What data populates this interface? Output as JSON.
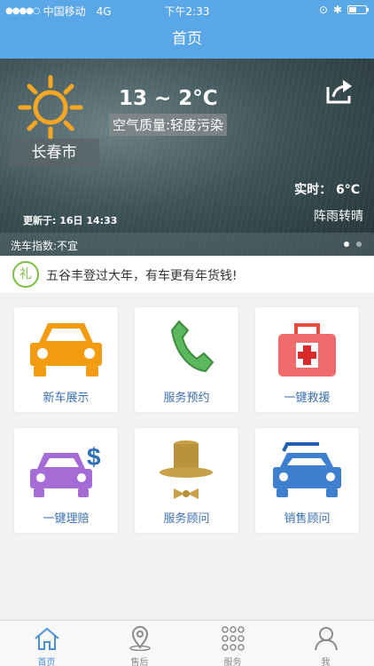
{
  "status_bar": {
    "carrier": "中国移动",
    "network": "4G",
    "time": "下午2:33"
  },
  "nav": {
    "title": "首页"
  },
  "weather": {
    "city": "长春市",
    "temperature_range": "13 ~ 2°C",
    "air_quality": "空气质量:轻度污染",
    "realtime": "实时：  6°C",
    "condition": "阵雨转晴",
    "updated": "更新于: 16日 14:33",
    "car_wash_index": "洗车指数:不宜",
    "pager_count": 2,
    "pager_active": 1
  },
  "notice": {
    "icon_text": "礼",
    "text": "五谷丰登过大年，有车更有年货钱!"
  },
  "grid": {
    "items": [
      {
        "label": "新车展示",
        "icon": "car-icon"
      },
      {
        "label": "服务预约",
        "icon": "phone-icon"
      },
      {
        "label": "一键救援",
        "icon": "first-aid-kit-icon"
      },
      {
        "label": "一键理赔",
        "icon": "car-dollar-icon"
      },
      {
        "label": "服务顾问",
        "icon": "top-hat-icon"
      },
      {
        "label": "销售顾问",
        "icon": "car-blue-icon"
      }
    ]
  },
  "tabbar": {
    "items": [
      {
        "label": "首页",
        "icon": "home-icon",
        "active": true
      },
      {
        "label": "售后",
        "icon": "location-pin-icon",
        "active": false
      },
      {
        "label": "服务",
        "icon": "grid-dots-icon",
        "active": false
      },
      {
        "label": "我",
        "icon": "user-icon",
        "active": false
      }
    ]
  },
  "colors": {
    "primary": "#5aa7e8",
    "link_text": "#3a6fb0",
    "tab_active": "#4a90d9",
    "sun": "#f5a623"
  }
}
